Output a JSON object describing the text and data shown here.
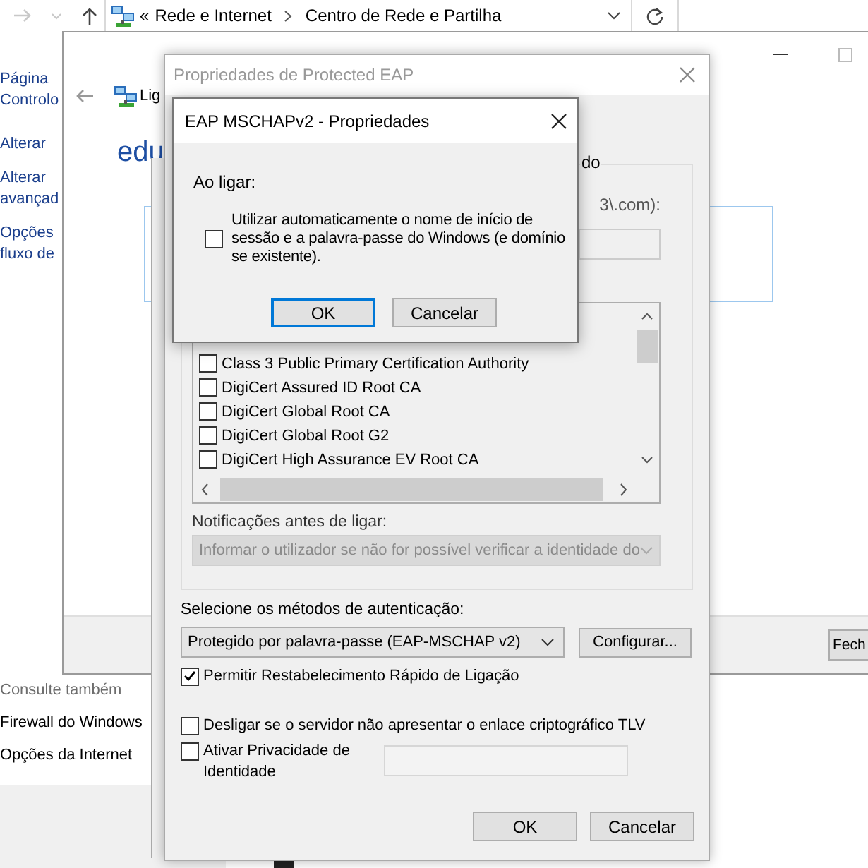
{
  "explorer": {
    "overflow_glyph": "«",
    "breadcrumbs": [
      "Rede e Internet",
      "Centro de Rede e Partilha"
    ],
    "sidebar": {
      "links": [
        {
          "lines": [
            "Página",
            "Controlo"
          ]
        },
        {
          "lines": [
            "Alterar"
          ]
        },
        {
          "lines": [
            "Alterar",
            "avançad"
          ]
        },
        {
          "lines": [
            "Opções",
            "fluxo de"
          ]
        }
      ]
    },
    "see_also": {
      "heading": "Consulte também",
      "links": [
        "Firewall do Windows",
        "Opções da Internet"
      ]
    }
  },
  "status_window": {
    "heading": "Lig",
    "network_name": "edu",
    "footer_button": "Fech"
  },
  "peap_dialog": {
    "title": "Propriedades de Protected EAP",
    "active": false,
    "group_title": "do",
    "server_hint": "3\\.com):",
    "certificates": [
      {
        "label": "Class 3 Public Primary Certification Authority",
        "checked": false
      },
      {
        "label": "DigiCert Assured ID Root CA",
        "checked": false
      },
      {
        "label": "DigiCert Global Root CA",
        "checked": false
      },
      {
        "label": "DigiCert Global Root G2",
        "checked": false
      },
      {
        "label": "DigiCert High Assurance EV Root CA",
        "checked": false
      }
    ],
    "notifications": {
      "label": "Notificações antes de ligar:",
      "value": "Informar o utilizador se não for possível verificar a identidade do",
      "disabled": true
    },
    "auth": {
      "label": "Selecione os métodos de autenticação:",
      "value": "Protegido por palavra-passe (EAP-MSCHAP v2)",
      "configure_button": "Configurar..."
    },
    "options": [
      {
        "label": "Permitir Restabelecimento Rápido de Ligação",
        "checked": true
      },
      {
        "label": "Desligar se o servidor não apresentar o enlace criptográfico TLV",
        "checked": false
      }
    ],
    "privacy": {
      "label": "Ativar Privacidade de Identidade",
      "checked": false
    },
    "buttons": [
      {
        "label": "OK"
      },
      {
        "label": "Cancelar"
      }
    ]
  },
  "mschap_dialog": {
    "title": "EAP MSCHAPv2 - Propriedades",
    "active": true,
    "section_label": "Ao ligar:",
    "option": {
      "label": "Utilizar automaticamente o nome de início de sessão e a palavra-passe do Windows (e domínio se existente).",
      "checked": false
    },
    "buttons": [
      {
        "label": "OK",
        "default": true
      },
      {
        "label": "Cancelar",
        "default": false
      }
    ]
  }
}
